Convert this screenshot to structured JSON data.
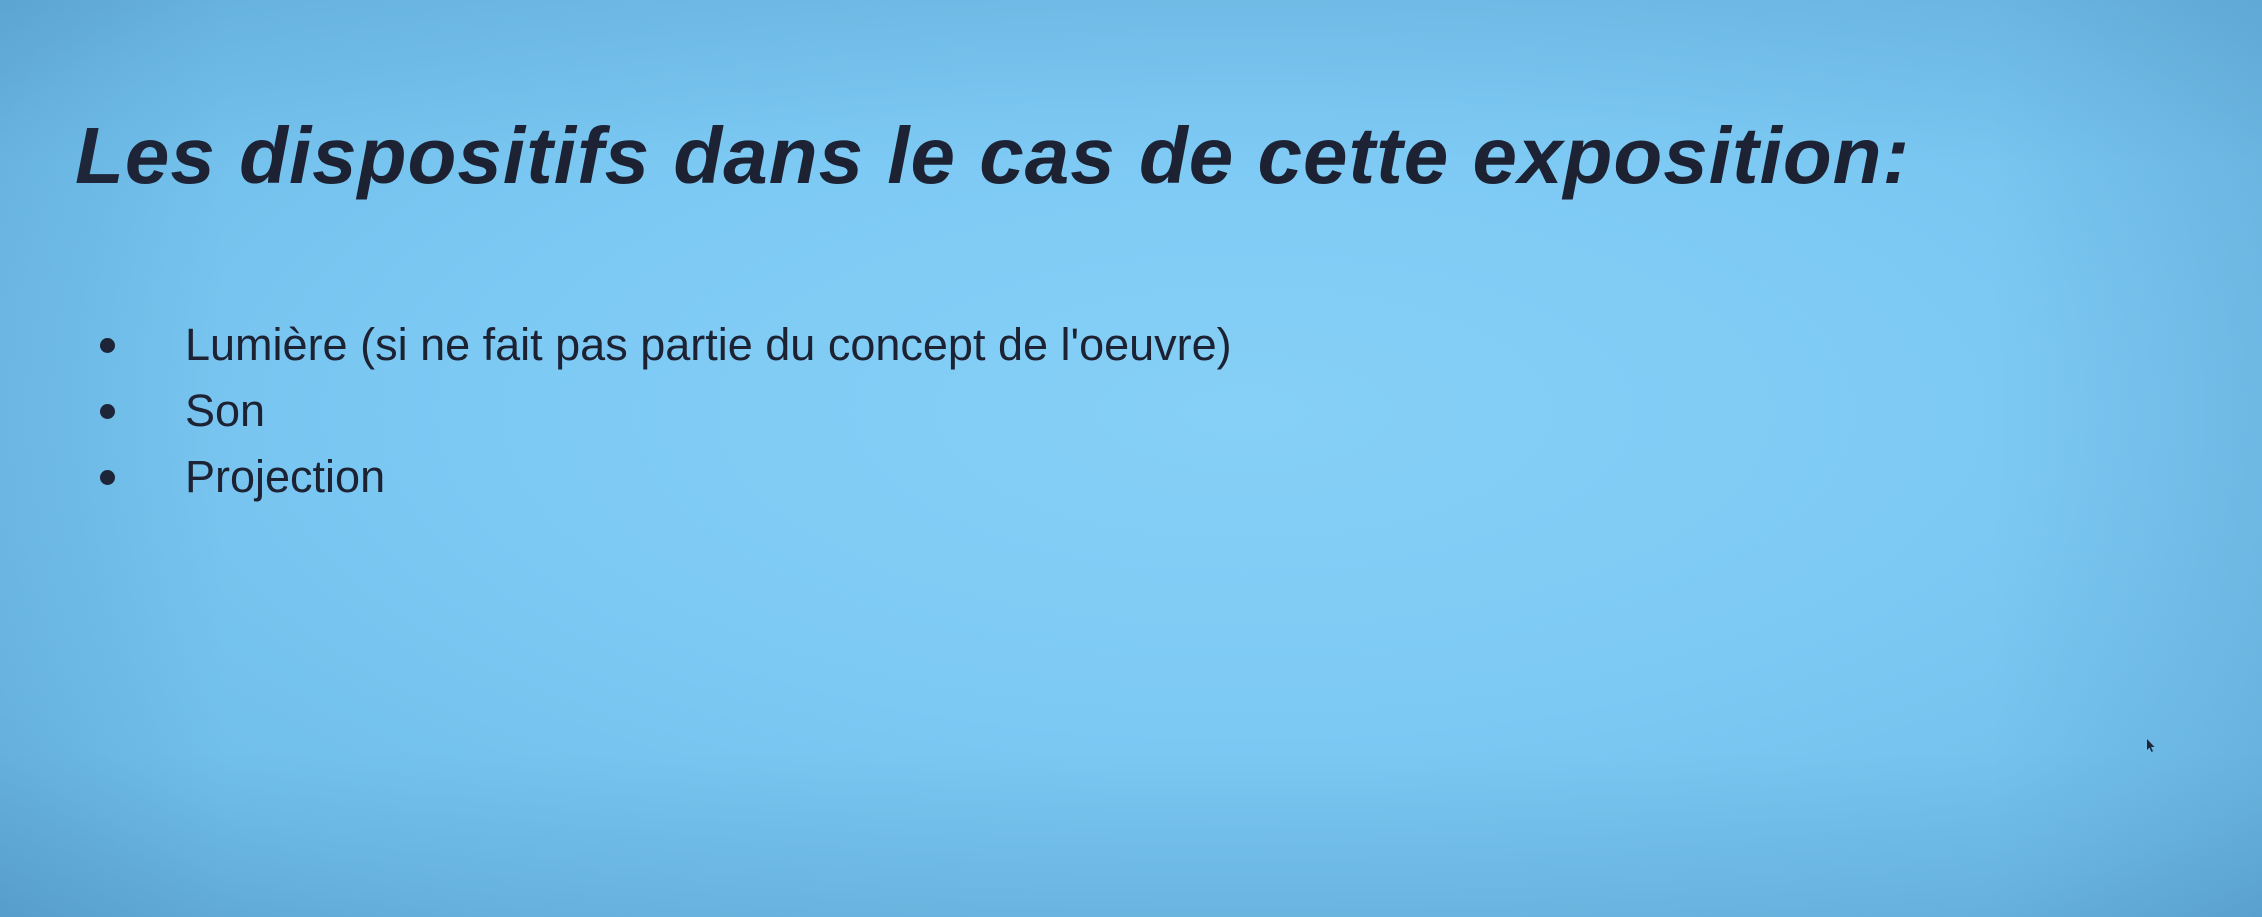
{
  "slide": {
    "title": "Les dispositifs dans le cas de cette exposition:",
    "bullets": [
      {
        "text": "Lumière (si ne fait pas partie du concept de l'oeuvre)"
      },
      {
        "text": "Son"
      },
      {
        "text": "Projection"
      }
    ]
  },
  "colors": {
    "background": "#7cc9f4",
    "text": "#1d2233"
  },
  "icons": {
    "bullet": "bullet-dot-icon",
    "pointer": "mouse-pointer-icon"
  }
}
